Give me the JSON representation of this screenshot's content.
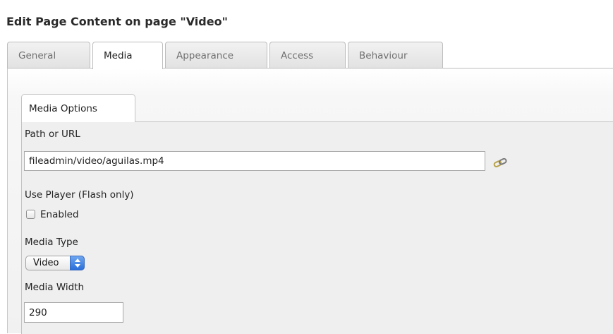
{
  "page_title": "Edit Page Content on page \"Video\"",
  "tabs": [
    {
      "label": "General",
      "active": false
    },
    {
      "label": "Media",
      "active": true
    },
    {
      "label": "Appearance",
      "active": false
    },
    {
      "label": "Access",
      "active": false
    },
    {
      "label": "Behaviour",
      "active": false
    }
  ],
  "subtab": {
    "label": "Media Options"
  },
  "fields": {
    "path_label": "Path or URL",
    "path_value": "fileadmin/video/aguilas.mp4",
    "use_player_label": "Use Player (Flash only)",
    "enabled_label": "Enabled",
    "enabled_checked": false,
    "media_type_label": "Media Type",
    "media_type_value": "Video",
    "media_width_label": "Media Width",
    "media_width_value": "290"
  },
  "icons": {
    "link": "link-wizard-icon",
    "select_arrows": "select-arrows-icon"
  },
  "colors": {
    "accent_select": "#2a6fd9",
    "title": "#2a2a2a"
  }
}
